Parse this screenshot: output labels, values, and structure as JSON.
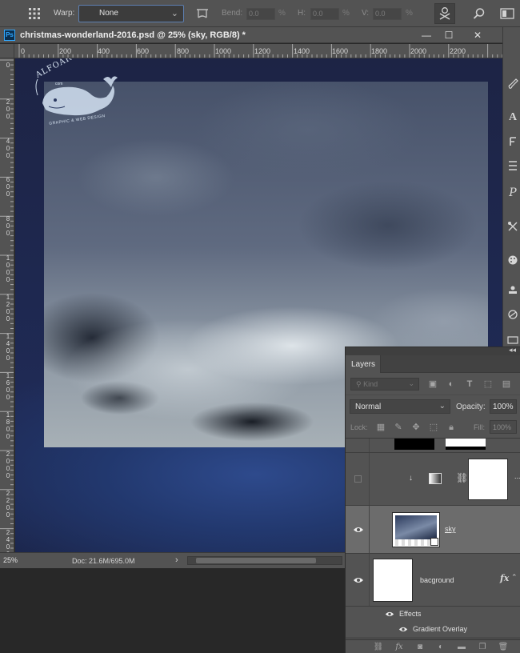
{
  "options_bar": {
    "warp_label": "Warp:",
    "warp_value": "None",
    "bend_label": "Bend:",
    "bend_value": "0.0",
    "h_label": "H:",
    "h_value": "0.0",
    "v_label": "V:",
    "v_value": "0.0",
    "percent": "%"
  },
  "document": {
    "app_badge": "Ps",
    "title": "christmas-wonderland-2016.psd @ 25% (sky, RGB/8) *",
    "minimize": "—",
    "restore": "☐",
    "close": "✕"
  },
  "rulers": {
    "horizontal": [
      "0",
      "200",
      "400",
      "600",
      "800",
      "1000",
      "1200",
      "1400",
      "1600",
      "1800",
      "2000",
      "2200"
    ],
    "vertical": [
      "0",
      "200",
      "400",
      "600",
      "800",
      "1000",
      "1200",
      "1400",
      "1600",
      "1800",
      "2000",
      "2200",
      "2400"
    ]
  },
  "logo": {
    "name": "ALFOART",
    "sub": "com",
    "tagline": "GRAPHIC & WEB DESIGN"
  },
  "status_bar": {
    "zoom": "25%",
    "doc_info": "Doc: 21.6M/695.0M",
    "arrow": "›"
  },
  "layers_panel": {
    "tab": "Layers",
    "collapse": "◂◂",
    "filter_kind": "Kind",
    "blend_mode": "Normal",
    "opacity_label": "Opacity:",
    "opacity_value": "100%",
    "lock_label": "Lock:",
    "fill_label": "Fill:",
    "fill_value": "100%",
    "layers": [
      {
        "name": ""
      },
      {
        "name": "",
        "clip_arrow": "↓"
      },
      {
        "name": "sky"
      },
      {
        "name": "bacground",
        "fx": "fx"
      }
    ],
    "effects_label": "Effects",
    "effect_name": "Gradient Overlay",
    "more": "..."
  },
  "icons": {
    "toolbar": [
      "grid-icon",
      "warp-icon",
      "cancel-icon",
      "search-icon",
      "workspace-icon"
    ],
    "right_tools": [
      "brush-icon",
      "type-icon",
      "paragraph-icon",
      "align-icon",
      "glyph-icon",
      "tools-icon",
      "palette-icon",
      "stamp-icon",
      "paths-icon"
    ],
    "footer": [
      "link-icon",
      "fx-icon",
      "mask-icon",
      "adjustment-icon",
      "folder-icon",
      "new-layer-icon",
      "trash-icon"
    ]
  },
  "colors": {
    "accent": "#31a8ff",
    "panel": "#535353",
    "workspace": "#282828"
  }
}
